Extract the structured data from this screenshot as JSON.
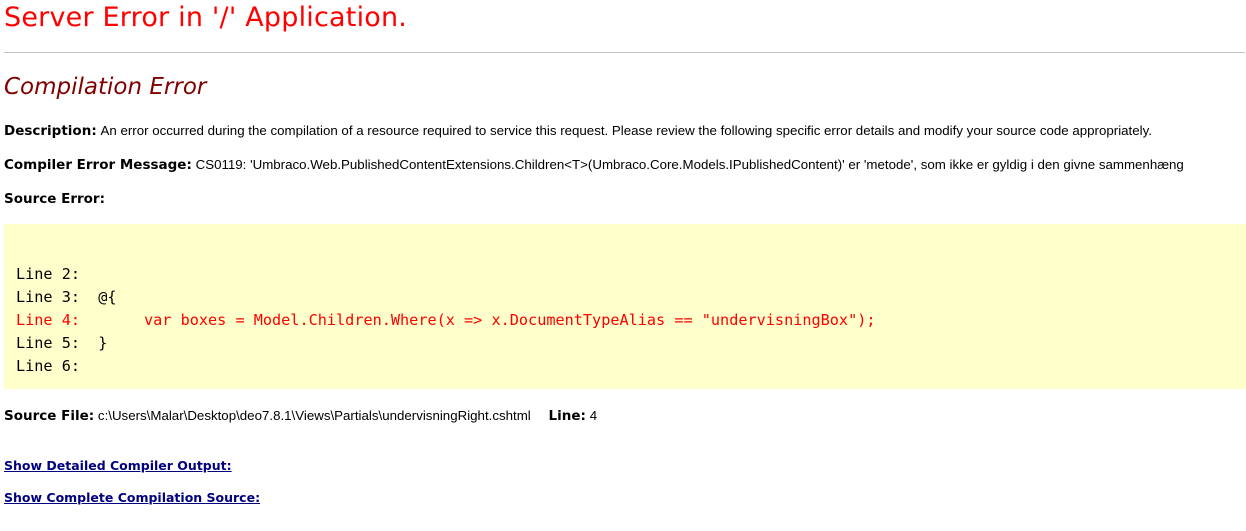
{
  "header": {
    "title": "Server Error in '/' Application.",
    "subtitle": "Compilation Error"
  },
  "description": {
    "label": "Description:",
    "text": "An error occurred during the compilation of a resource required to service this request. Please review the following specific error details and modify your source code appropriately."
  },
  "compiler_error": {
    "label": "Compiler Error Message:",
    "text": "CS0119: 'Umbraco.Web.PublishedContentExtensions.Children<T>(Umbraco.Core.Models.IPublishedContent)' er 'metode', som ikke er gyldig i den givne sammenhæng"
  },
  "source_error": {
    "label": "Source Error:",
    "lines": [
      {
        "text": "Line 2:",
        "highlight": false
      },
      {
        "text": "Line 3:  @{",
        "highlight": false
      },
      {
        "text": "Line 4:       var boxes = Model.Children.Where(x => x.DocumentTypeAlias == \"undervisningBox\");",
        "highlight": true
      },
      {
        "text": "Line 5:  }",
        "highlight": false
      },
      {
        "text": "Line 6:",
        "highlight": false
      }
    ]
  },
  "source_file": {
    "label": "Source File:",
    "path": "c:\\Users\\Malar\\Desktop\\deo7.8.1\\Views\\Partials\\undervisningRight.cshtml",
    "line_label": "Line:",
    "line_value": "4"
  },
  "links": {
    "detailed_output": "Show Detailed Compiler Output:",
    "complete_source": "Show Complete Compilation Source:"
  },
  "colors": {
    "title": "#ff0000",
    "subtitle": "#800000",
    "code_background": "#ffffcc",
    "error_line": "#ff0000",
    "link": "#000080"
  }
}
